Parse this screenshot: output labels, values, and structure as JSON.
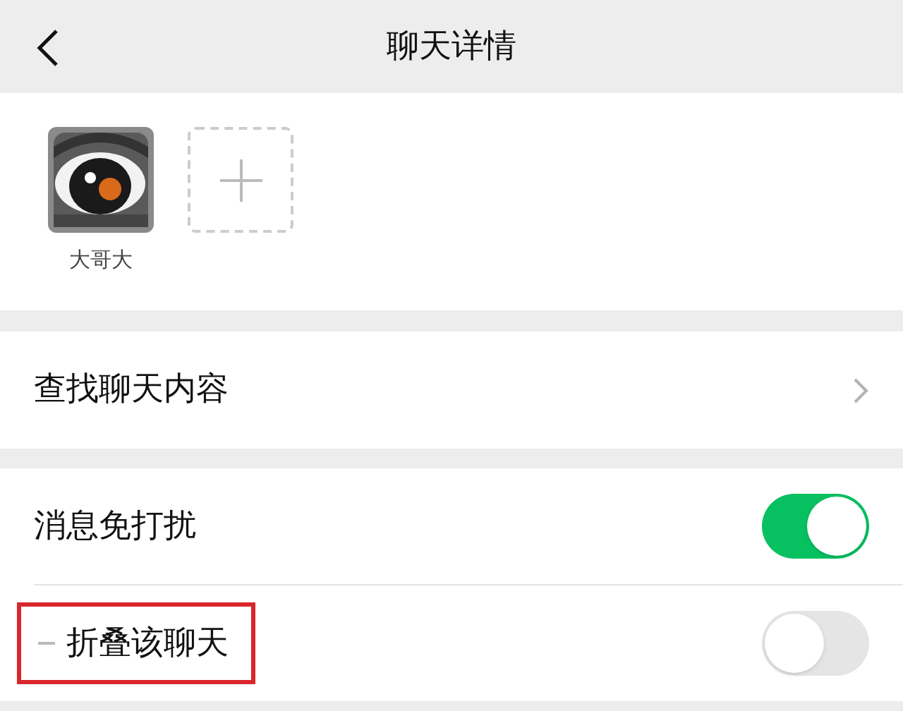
{
  "header": {
    "title": "聊天详情"
  },
  "members": [
    {
      "name": "大哥大",
      "kind": "picture"
    }
  ],
  "rows": [
    {
      "kind": "link",
      "label": "查找聊天内容"
    },
    {
      "kind": "toggle",
      "label": "消息免打扰",
      "on": true,
      "highlighted": false
    },
    {
      "kind": "toggle",
      "label": "折叠该聊天",
      "on": false,
      "highlighted": true
    }
  ]
}
